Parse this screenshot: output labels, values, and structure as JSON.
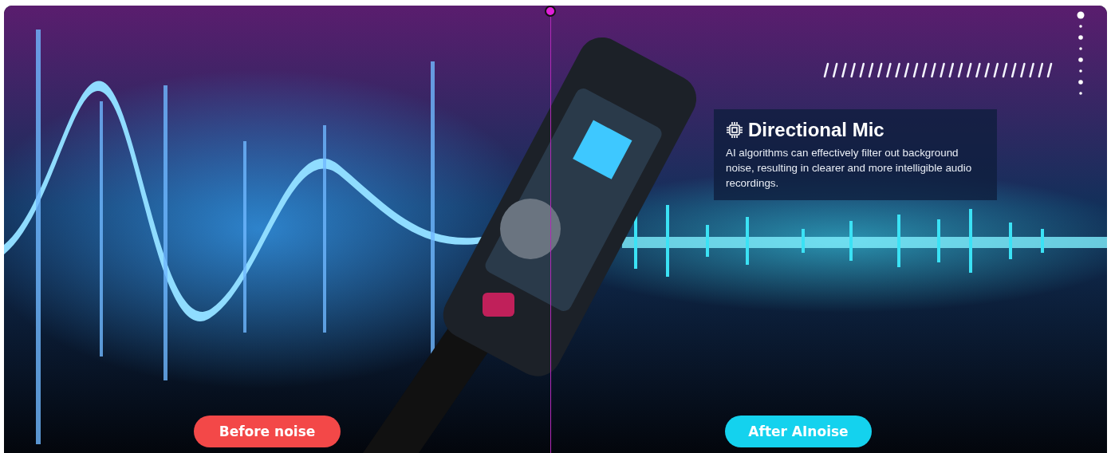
{
  "comparison": {
    "divider": {
      "level": 0.495
    },
    "before_label": "Before noise",
    "after_label": "After AInoise"
  },
  "feature": {
    "title": "Directional Mic",
    "description": "AI algorithms can effectively filter out background noise, resulting in clearer and more intelligible audio recordings."
  }
}
